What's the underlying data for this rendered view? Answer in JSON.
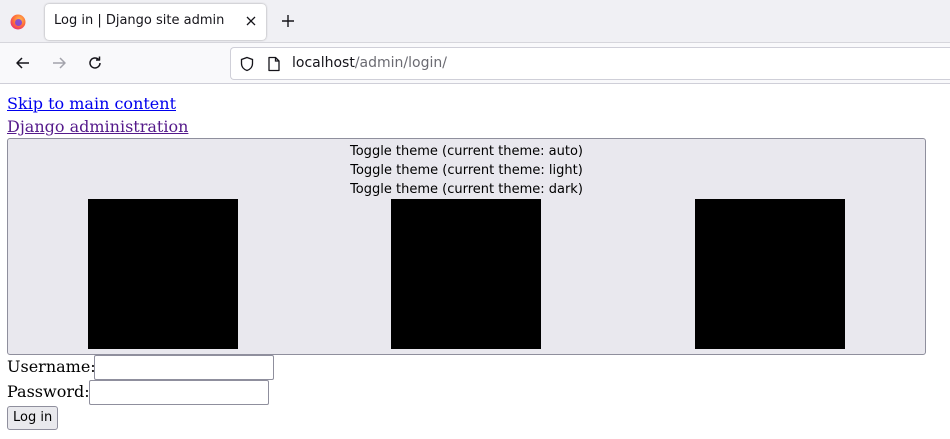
{
  "browser": {
    "tab_title": "Log in | Django site admin",
    "url_host": "localhost",
    "url_path": "/admin/login/",
    "icons": {
      "app": "firefox-logo-icon",
      "tab_close": "close-icon",
      "new_tab": "plus-icon",
      "back": "arrow-left-icon",
      "forward": "arrow-right-icon",
      "reload": "reload-icon",
      "security": "shield-icon",
      "page": "page-icon"
    }
  },
  "page": {
    "skip_link": "Skip to main content",
    "site_link": "Django administration",
    "theme_toggle": {
      "auto": "Toggle theme (current theme: auto)",
      "light": "Toggle theme (current theme: light)",
      "dark": "Toggle theme (current theme: dark)"
    },
    "form": {
      "username_label": "Username:",
      "username_value": "",
      "password_label": "Password:",
      "password_value": "",
      "submit_label": "Log in"
    }
  },
  "colors": {
    "link": "#0000ee",
    "visited_link": "#551a8b",
    "theme_box_bg": "#e9e8ee",
    "theme_icon_fill": "#000000"
  }
}
